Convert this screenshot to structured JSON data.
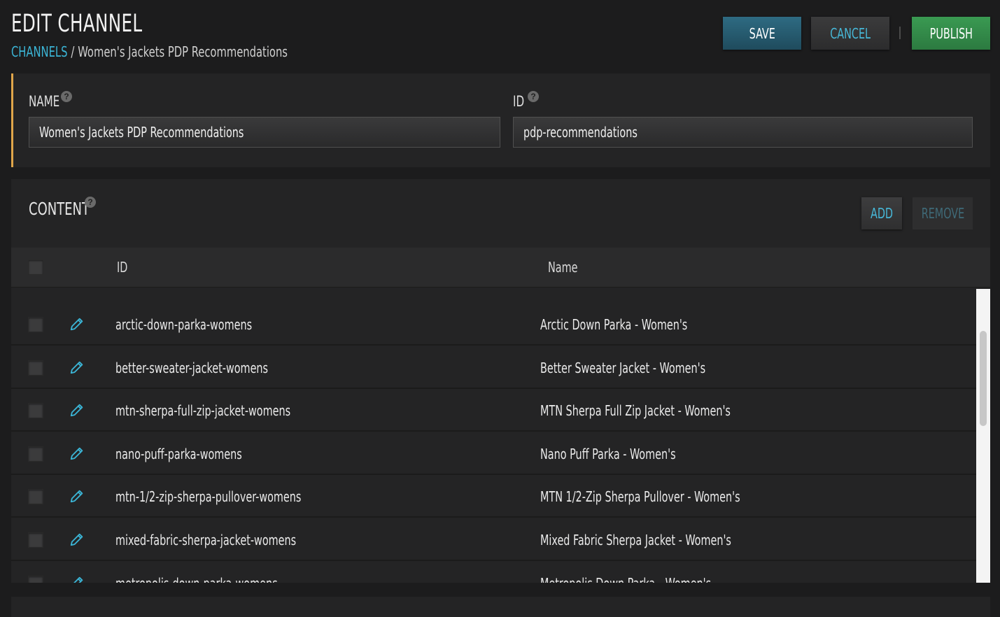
{
  "header": {
    "title": "EDIT CHANNEL",
    "breadcrumb": {
      "link": "CHANNELS",
      "separator": "/",
      "current": "Women's Jackets PDP Recommendations"
    },
    "buttons": {
      "save": "SAVE",
      "cancel": "CANCEL",
      "publish": "PUBLISH"
    }
  },
  "meta": {
    "name_label": "NAME",
    "name_value": "Women's Jackets PDP Recommendations",
    "id_label": "ID",
    "id_value": "pdp-recommendations",
    "help_glyph": "?"
  },
  "content": {
    "title": "CONTENT",
    "add_label": "ADD",
    "remove_label": "REMOVE",
    "columns": {
      "id": "ID",
      "name": "Name"
    },
    "rows": [
      {
        "id": "arctic-down-parka-womens",
        "name": "Arctic Down Parka - Women's"
      },
      {
        "id": "better-sweater-jacket-womens",
        "name": "Better Sweater Jacket - Women's"
      },
      {
        "id": "mtn-sherpa-full-zip-jacket-womens",
        "name": "MTN Sherpa Full Zip Jacket - Women's"
      },
      {
        "id": "nano-puff-parka-womens",
        "name": "Nano Puff Parka - Women's"
      },
      {
        "id": "mtn-1/2-zip-sherpa-pullover-womens",
        "name": "MTN 1/2-Zip Sherpa Pullover - Women's"
      },
      {
        "id": "mixed-fabric-sherpa-jacket-womens",
        "name": "Mixed Fabric Sherpa Jacket - Women's"
      },
      {
        "id": "metropolis-down-parka-womens",
        "name": "Metropolis Down Parka - Women's"
      }
    ]
  },
  "colors": {
    "accent": "#3bb5d6",
    "save": "#2e6b82",
    "publish": "#3a9a52",
    "highlight_border": "#e0a54a",
    "background": "#1c1c1d"
  },
  "icons": {
    "edit": "pencil-icon",
    "help": "help-icon"
  }
}
